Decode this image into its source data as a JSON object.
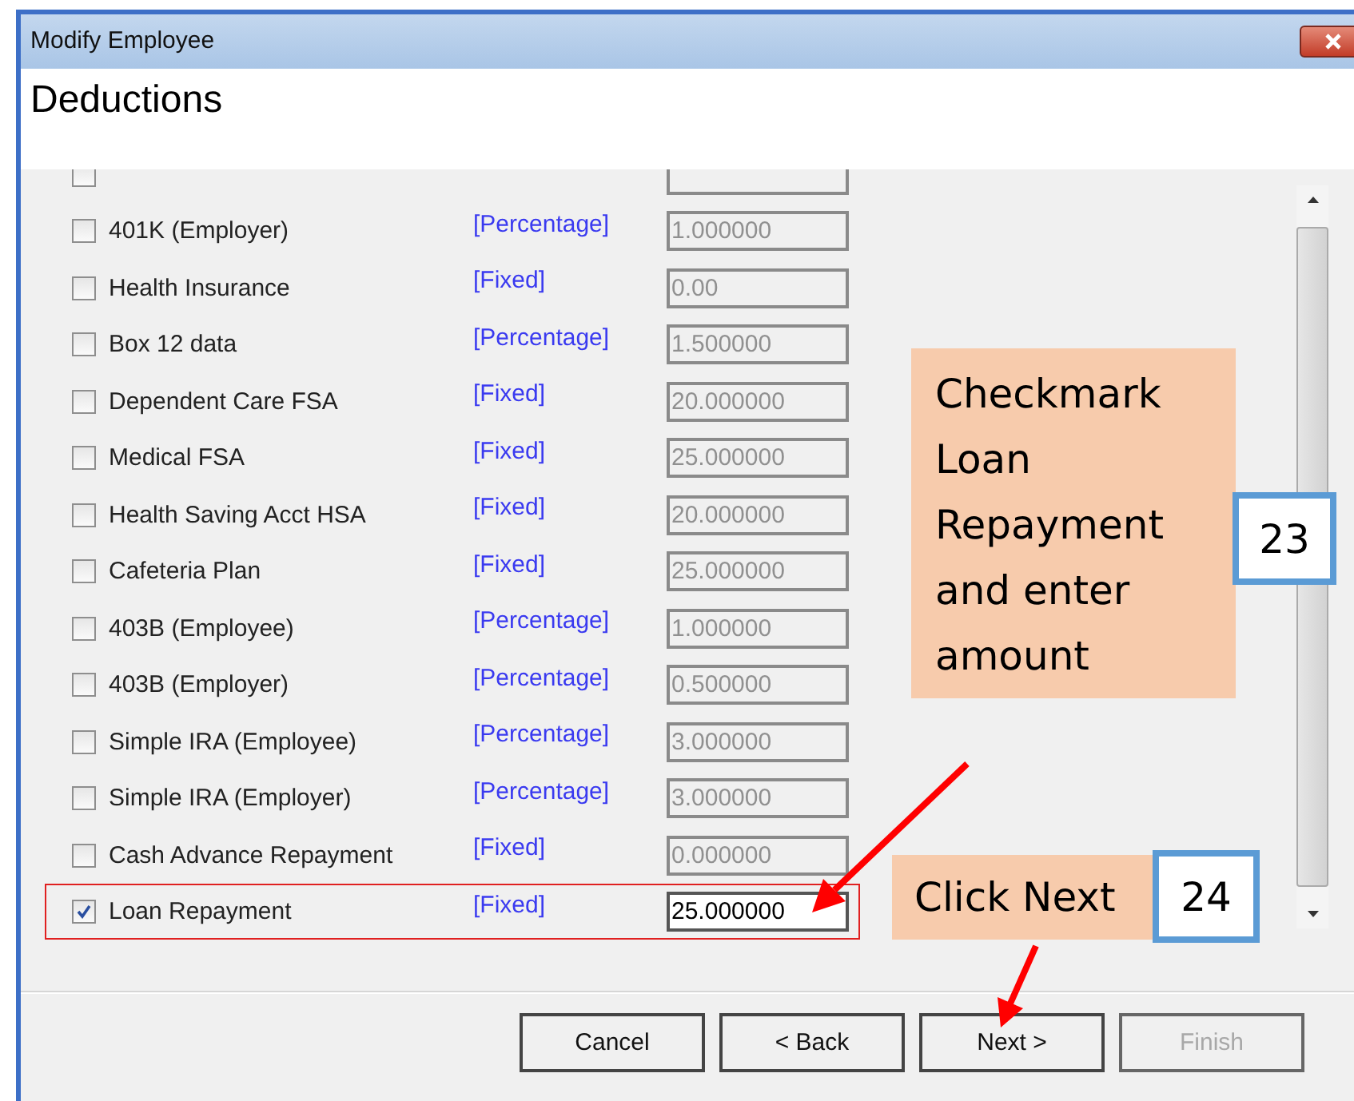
{
  "window": {
    "title": "Modify Employee",
    "heading": "Deductions"
  },
  "deductions": [
    {
      "checked": false,
      "highlighted": false
    },
    {
      "name": "401K (Employer)",
      "type": "[Percentage]",
      "amount": "1.000000",
      "checked": false,
      "highlighted": false
    },
    {
      "name": "Health Insurance",
      "type": "[Fixed]",
      "amount": "0.00",
      "checked": false,
      "highlighted": false
    },
    {
      "name": "Box 12 data",
      "type": "[Percentage]",
      "amount": "1.500000",
      "checked": false,
      "highlighted": false
    },
    {
      "name": "Dependent Care FSA",
      "type": "[Fixed]",
      "amount": "20.000000",
      "checked": false,
      "highlighted": false
    },
    {
      "name": "Medical FSA",
      "type": "[Fixed]",
      "amount": "25.000000",
      "checked": false,
      "highlighted": false
    },
    {
      "name": "Health Saving Acct HSA",
      "type": "[Fixed]",
      "amount": "20.000000",
      "checked": false,
      "highlighted": false
    },
    {
      "name": "Cafeteria Plan",
      "type": "[Fixed]",
      "amount": "25.000000",
      "checked": false,
      "highlighted": false
    },
    {
      "name": "403B (Employee)",
      "type": "[Percentage]",
      "amount": "1.000000",
      "checked": false,
      "highlighted": false
    },
    {
      "name": "403B (Employer)",
      "type": "[Percentage]",
      "amount": "0.500000",
      "checked": false,
      "highlighted": false
    },
    {
      "name": "Simple IRA (Employee)",
      "type": "[Percentage]",
      "amount": "3.000000",
      "checked": false,
      "highlighted": false
    },
    {
      "name": "Simple IRA (Employer)",
      "type": "[Percentage]",
      "amount": "3.000000",
      "checked": false,
      "highlighted": false
    },
    {
      "name": "Cash Advance Repayment",
      "type": "[Fixed]",
      "amount": "0.000000",
      "checked": false,
      "highlighted": false
    },
    {
      "name": "Loan Repayment",
      "type": "[Fixed]",
      "amount": "25.000000",
      "checked": true,
      "highlighted": true
    }
  ],
  "buttons": [
    {
      "label": "Cancel",
      "disabled": false
    },
    {
      "label": "< Back",
      "disabled": false
    },
    {
      "label": "Next >",
      "disabled": false
    },
    {
      "label": "Finish",
      "disabled": true
    }
  ],
  "annotations": [
    {
      "text": "Checkmark Loan Repayment and enter amount",
      "step": "23"
    },
    {
      "text": "Click Next",
      "step": "24"
    }
  ]
}
